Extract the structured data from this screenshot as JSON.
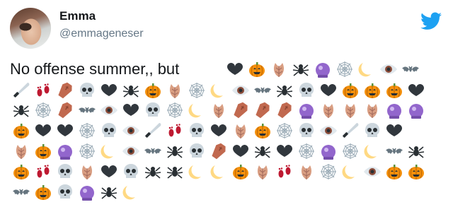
{
  "author": {
    "name": "Emma",
    "handle": "@emmageneser"
  },
  "tweet": {
    "text": "No offense summer,, but"
  },
  "brand": {
    "icon": "twitter-bird-icon",
    "color": "#1da1f2"
  },
  "emoji_rows": [
    [
      "heart",
      "pumpkin",
      "leaf",
      "spider",
      "ball",
      "web",
      "moon",
      "eye",
      "bat"
    ],
    [
      "knife",
      "feet",
      "coffin",
      "skull",
      "heart",
      "spider",
      "pumpkin",
      "leaf",
      "web",
      "moon",
      "eye",
      "bat",
      "spider",
      "skull",
      "heart",
      "pumpkin",
      "pumpkin",
      "pumpkin",
      "heart"
    ],
    [
      "spider",
      "web",
      "coffin",
      "bat",
      "eye",
      "heart",
      "skull",
      "web",
      "moon",
      "leaf",
      "coffin",
      "coffin",
      "coffin",
      "ball",
      "leaf",
      "leaf",
      "leaf",
      "ball",
      "ball"
    ],
    [
      "pumpkin",
      "heart",
      "heart",
      "web",
      "skull",
      "eye",
      "knife",
      "feet",
      "skull",
      "heart",
      "leaf",
      "pumpkin",
      "web",
      "skull",
      "eye",
      "knife",
      "skull",
      "heart"
    ],
    [
      "leaf",
      "pumpkin",
      "ball",
      "web",
      "moon",
      "eye",
      "bat",
      "spider",
      "skull",
      "coffin",
      "heart",
      "spider",
      "heart",
      "web",
      "ball",
      "web",
      "moon",
      "bat",
      "spider"
    ],
    [
      "pumpkin",
      "feet",
      "skull",
      "leaf",
      "heart",
      "skull",
      "spider",
      "spider",
      "moon",
      "moon",
      "pumpkin",
      "leaf",
      "feet",
      "leaf",
      "web",
      "moon",
      "eye",
      "pumpkin",
      "pumpkin"
    ],
    [
      "bat",
      "pumpkin",
      "skull",
      "ball",
      "spider",
      "moon"
    ]
  ]
}
